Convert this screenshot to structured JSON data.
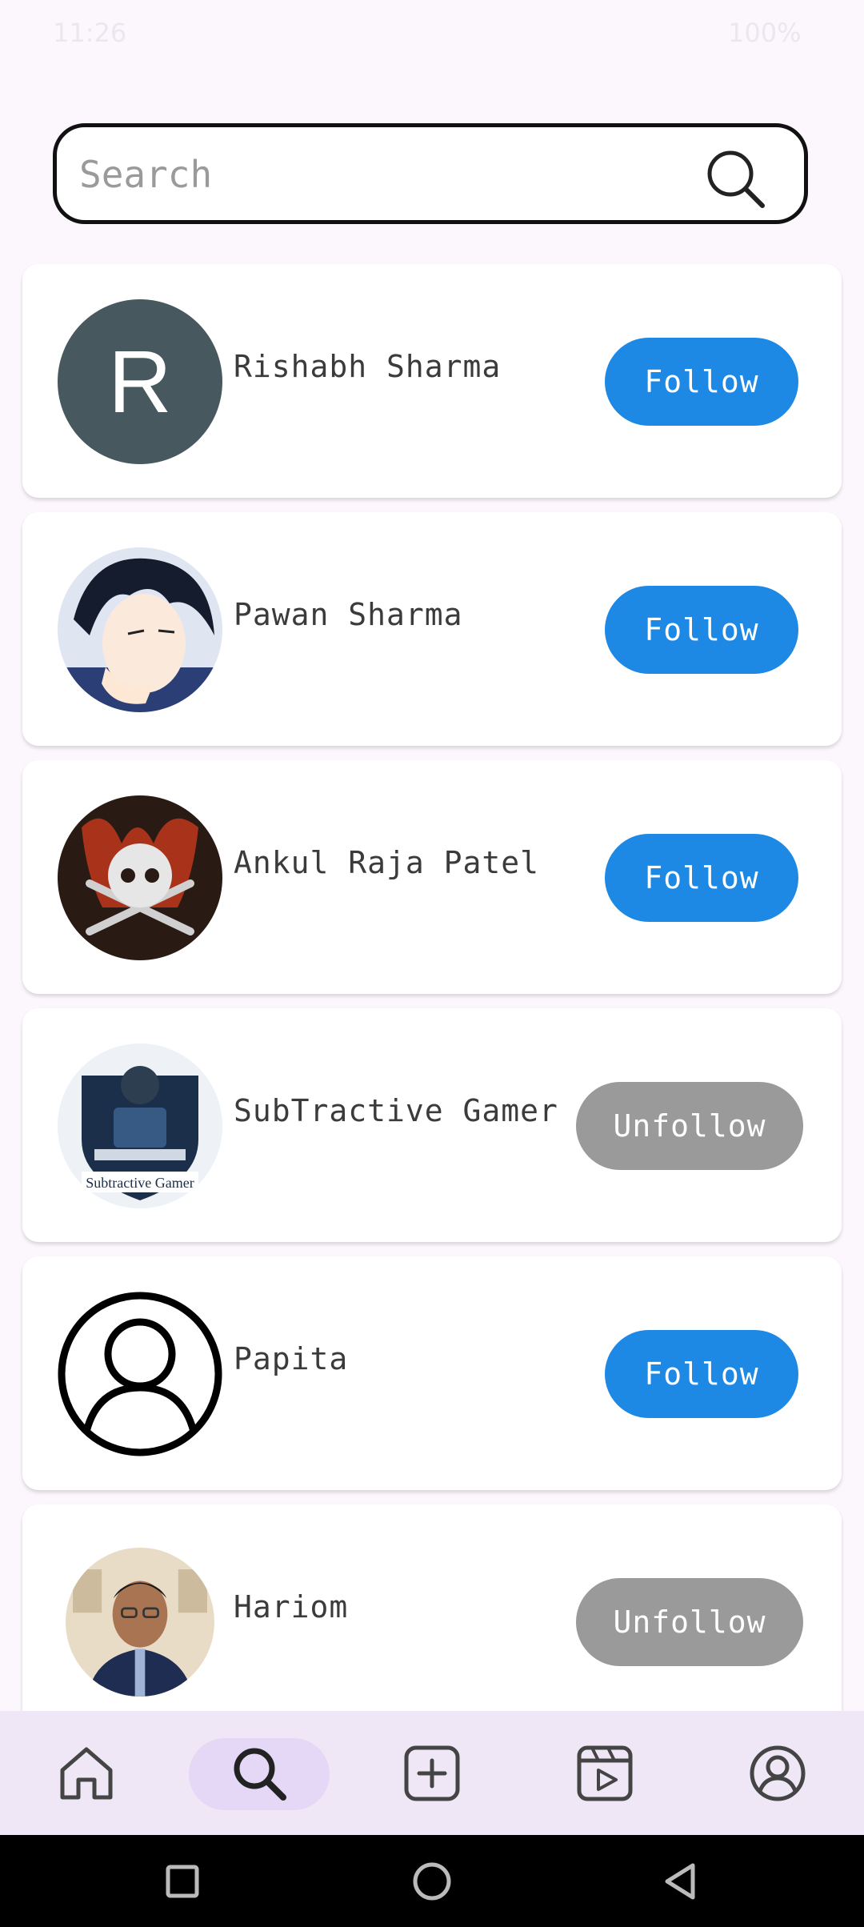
{
  "status_bar": {
    "time": "11:26",
    "battery": "100%"
  },
  "search": {
    "placeholder": "Search",
    "value": ""
  },
  "users": [
    {
      "name": "Rishabh Sharma",
      "avatar_type": "letter",
      "avatar_letter": "R",
      "button": "Follow",
      "state": "follow"
    },
    {
      "name": "Pawan Sharma",
      "avatar_type": "anime-boy-icon",
      "button": "Follow",
      "state": "follow"
    },
    {
      "name": "Ankul Raja Patel",
      "avatar_type": "skull-crossbones-icon",
      "button": "Follow",
      "state": "follow"
    },
    {
      "name": "SubTractive Gamer",
      "avatar_type": "gamer-logo-icon",
      "logo_text": "Subtractive Gamer",
      "button": "Unfollow",
      "state": "unfollow"
    },
    {
      "name": "Papita",
      "avatar_type": "default-user-icon",
      "button": "Follow",
      "state": "follow"
    },
    {
      "name": "Hariom",
      "avatar_type": "photo-man-icon",
      "button": "Unfollow",
      "state": "unfollow"
    }
  ],
  "bottom_nav": [
    {
      "icon": "home-icon",
      "active": false
    },
    {
      "icon": "search-icon",
      "active": true
    },
    {
      "icon": "add-post-icon",
      "active": false
    },
    {
      "icon": "reels-icon",
      "active": false
    },
    {
      "icon": "profile-icon",
      "active": false
    }
  ],
  "colors": {
    "follow": "#1e88e5",
    "unfollow": "#9a9a9a",
    "nav_bg": "#efe7f6",
    "nav_active": "#e4d8f6"
  }
}
